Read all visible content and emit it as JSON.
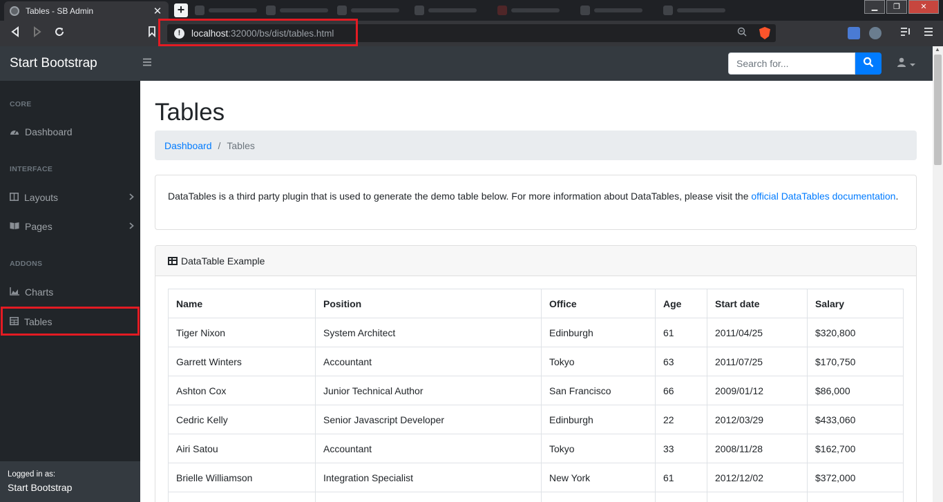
{
  "browser": {
    "tab_title": "Tables - SB Admin",
    "url_host": "localhost",
    "url_path": ":32000/bs/dist/tables.html"
  },
  "navbar": {
    "brand": "Start Bootstrap",
    "search_placeholder": "Search for..."
  },
  "sidebar": {
    "heading_core": "CORE",
    "heading_interface": "INTERFACE",
    "heading_addons": "ADDONS",
    "items": [
      {
        "label": "Dashboard"
      },
      {
        "label": "Layouts"
      },
      {
        "label": "Pages"
      },
      {
        "label": "Charts"
      },
      {
        "label": "Tables"
      }
    ],
    "footer_small": "Logged in as:",
    "footer_name": "Start Bootstrap"
  },
  "main": {
    "title": "Tables",
    "breadcrumb_link": "Dashboard",
    "breadcrumb_sep": "/",
    "breadcrumb_current": "Tables",
    "intro_text": "DataTables is a third party plugin that is used to generate the demo table below. For more information about DataTables, please visit the ",
    "intro_link": "official DataTables documentation",
    "intro_end": ".",
    "card_title": "DataTable Example",
    "columns": [
      "Name",
      "Position",
      "Office",
      "Age",
      "Start date",
      "Salary"
    ],
    "rows": [
      [
        "Tiger Nixon",
        "System Architect",
        "Edinburgh",
        "61",
        "2011/04/25",
        "$320,800"
      ],
      [
        "Garrett Winters",
        "Accountant",
        "Tokyo",
        "63",
        "2011/07/25",
        "$170,750"
      ],
      [
        "Ashton Cox",
        "Junior Technical Author",
        "San Francisco",
        "66",
        "2009/01/12",
        "$86,000"
      ],
      [
        "Cedric Kelly",
        "Senior Javascript Developer",
        "Edinburgh",
        "22",
        "2012/03/29",
        "$433,060"
      ],
      [
        "Airi Satou",
        "Accountant",
        "Tokyo",
        "33",
        "2008/11/28",
        "$162,700"
      ],
      [
        "Brielle Williamson",
        "Integration Specialist",
        "New York",
        "61",
        "2012/12/02",
        "$372,000"
      ],
      [
        "",
        "",
        "",
        "",
        "",
        ""
      ]
    ]
  },
  "colors": {
    "navbar": "#343a40",
    "sidebar": "#212529",
    "link": "#007bff",
    "highlight": "#e31b23"
  }
}
